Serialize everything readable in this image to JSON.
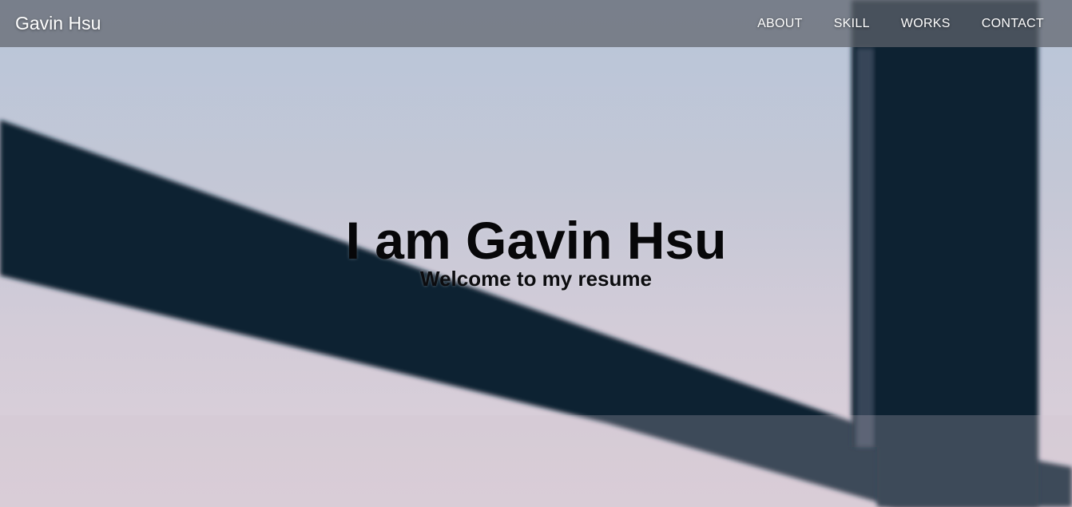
{
  "navbar": {
    "brand": "Gavin Hsu",
    "links": [
      {
        "label": "ABOUT"
      },
      {
        "label": "SKILL"
      },
      {
        "label": "WORKS"
      },
      {
        "label": "CONTACT"
      }
    ]
  },
  "hero": {
    "title": "I am Gavin Hsu",
    "subtitle": "Welcome to my resume"
  },
  "colors": {
    "navbar_bg": "#60646c",
    "nav_text": "#ffffff",
    "headline_text": "#070709",
    "beam_color": "#0f2233",
    "sky_top": "#b8c6d9",
    "sky_bottom": "#ddd0da"
  }
}
